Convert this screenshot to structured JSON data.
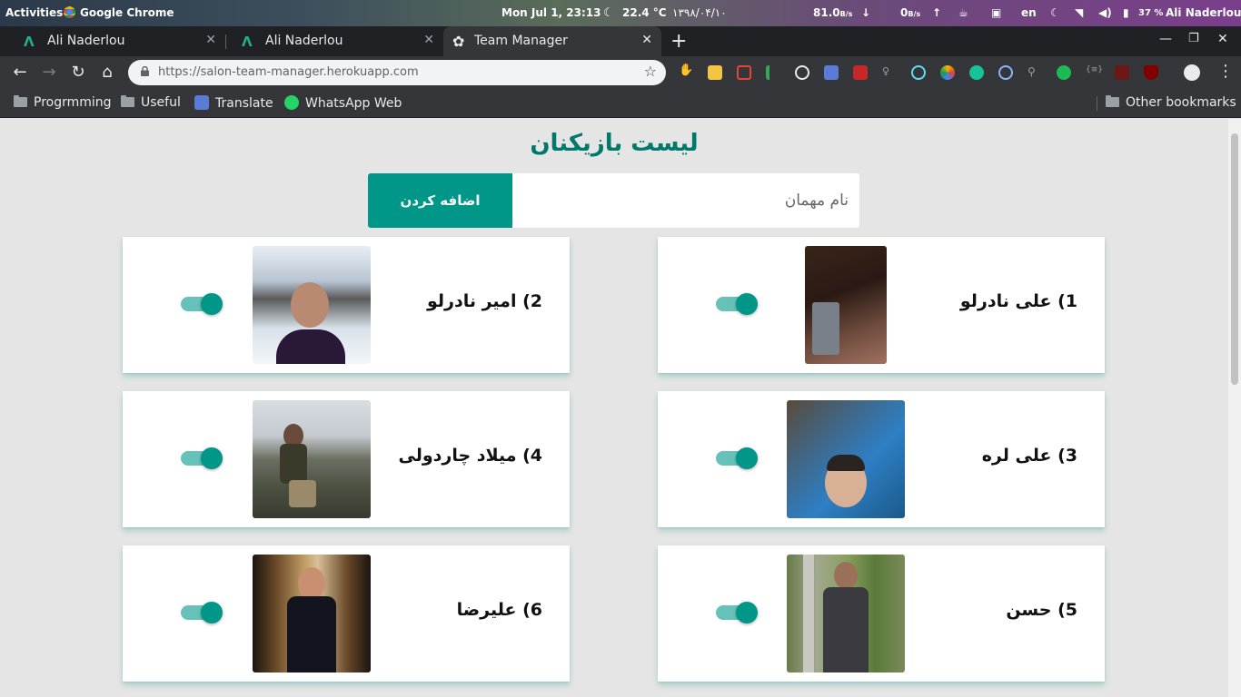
{
  "system_bar": {
    "activities": "Activities",
    "app_name": "Google Chrome",
    "clock": "Mon Jul  1, 23:13",
    "temperature": "22.4 °C",
    "persian_date": "۱۳۹۸/۰۴/۱۰",
    "download_speed": "81.0",
    "download_unit": "B/s",
    "upload_speed": "0",
    "upload_unit": "B/s",
    "keyboard_lang": "en",
    "battery": "37 %",
    "user": "Ali Naderlou"
  },
  "tabs": [
    {
      "title": "Ali Naderlou",
      "icon": "vuetify-icon",
      "active": false
    },
    {
      "title": "Ali Naderlou",
      "icon": "vuetify-icon",
      "active": false
    },
    {
      "title": "Team Manager",
      "icon": "gear-icon",
      "active": true
    }
  ],
  "tab_close_glyph": "✕",
  "address_bar": {
    "url": "https://salon-team-manager.herokuapp.com"
  },
  "bookmarks": [
    {
      "label": "Progrmming",
      "icon": "folder-icon"
    },
    {
      "label": "Useful",
      "icon": "folder-icon"
    },
    {
      "label": "Translate",
      "icon": "translate-icon"
    },
    {
      "label": "WhatsApp Web",
      "icon": "whatsapp-icon"
    }
  ],
  "other_bookmarks": "Other bookmarks",
  "page": {
    "title": "لیست بازیکنان",
    "guest_placeholder": "نام مهمان",
    "add_button": "اضافه کردن"
  },
  "players": [
    {
      "label": "1) علی نادرلو",
      "enabled": true
    },
    {
      "label": "2) امیر نادرلو",
      "enabled": true
    },
    {
      "label": "3) علی لره",
      "enabled": true
    },
    {
      "label": "4) میلاد چاردولی",
      "enabled": true
    },
    {
      "label": "5) حسن",
      "enabled": true
    },
    {
      "label": "6) علیرضا",
      "enabled": true
    }
  ],
  "colors": {
    "accent": "#009688",
    "title": "#00796b",
    "page_bg": "#e5e5e5"
  }
}
